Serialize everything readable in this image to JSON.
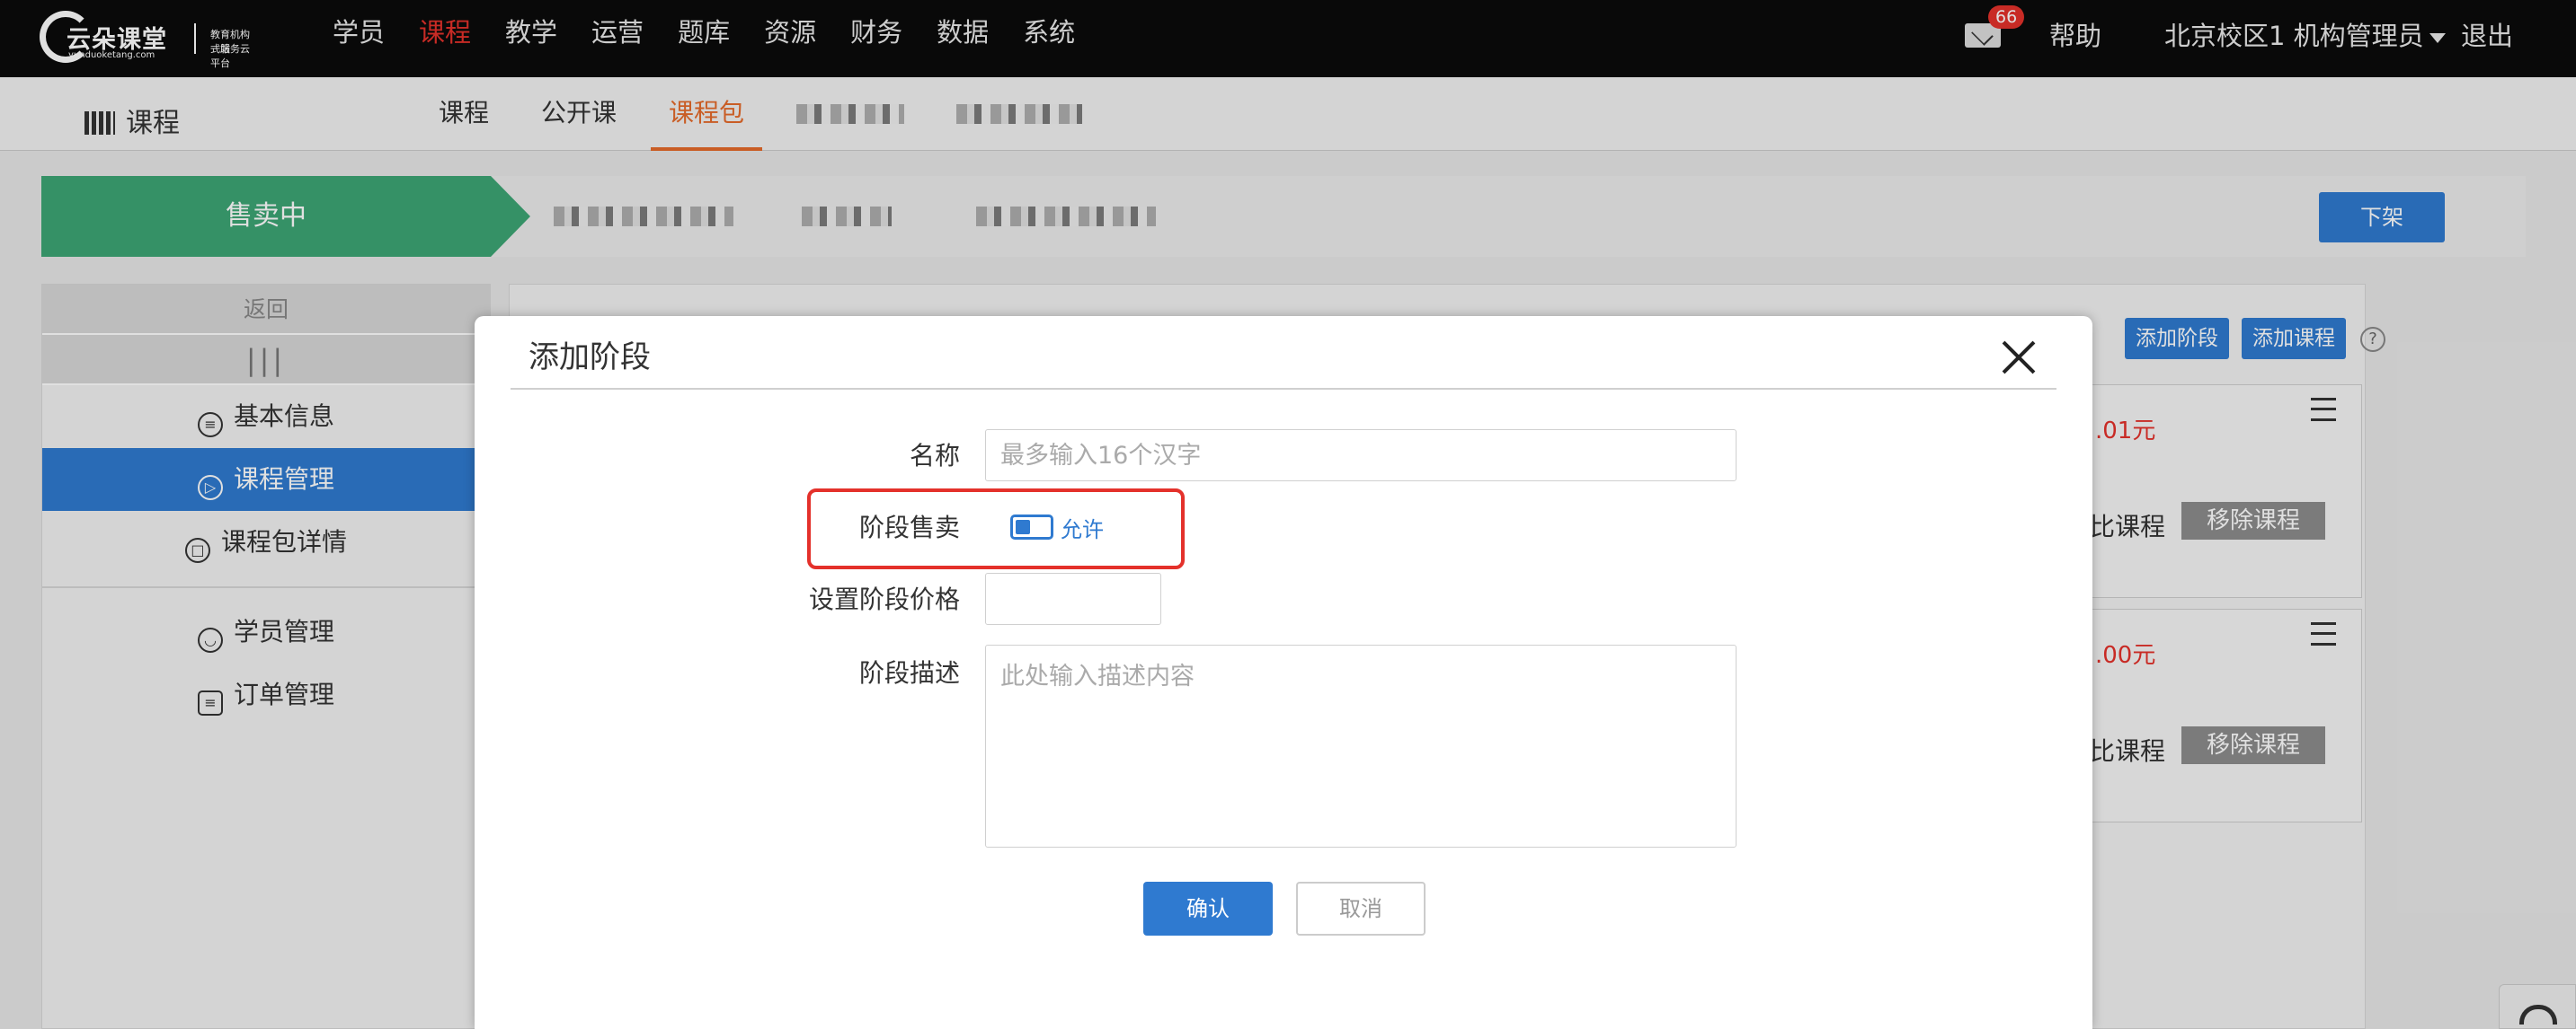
{
  "topnav": {
    "logo_main": "云朵课堂",
    "logo_url": "yunduoketang.com",
    "logo_sub1": "教育机构一站",
    "logo_sub2": "式服务云平台",
    "items": [
      "学员",
      "课程",
      "教学",
      "运营",
      "题库",
      "资源",
      "财务",
      "数据",
      "系统"
    ],
    "active_item": "课程",
    "mail_badge": "66",
    "help": "帮助",
    "user": "北京校区1 机构管理员",
    "logout": "退出"
  },
  "subnav": {
    "title": "课程",
    "tabs": [
      "课程",
      "公开课",
      "课程包"
    ],
    "active_tab": "课程包"
  },
  "status": {
    "sale_label": "售卖中",
    "takeoff_button": "下架"
  },
  "sidebar": {
    "back": "返回",
    "grip": "|||",
    "items": [
      "基本信息",
      "课程管理",
      "课程包详情",
      "学员管理",
      "订单管理"
    ],
    "active_item": "课程管理"
  },
  "content": {
    "add_stage_button": "添加阶段",
    "add_course_button": "添加课程",
    "help_icon_text": "?",
    "cards": [
      {
        "price": ".01元",
        "cut_text": "比课程",
        "remove_button": "移除课程"
      },
      {
        "price": ".00元",
        "cut_text": "比课程",
        "remove_button": "移除课程"
      }
    ]
  },
  "dialog": {
    "title": "添加阶段",
    "name_label": "名称",
    "name_placeholder": "最多输入16个汉字",
    "sell_label": "阶段售卖",
    "sell_toggle_label": "允许",
    "price_label": "设置阶段价格",
    "price_value": "",
    "desc_label": "阶段描述",
    "desc_placeholder": "此处输入描述内容",
    "confirm_button": "确认",
    "cancel_button": "取消"
  },
  "colors": {
    "accent_blue": "#2f7ad0",
    "active_red": "#e4312b",
    "tab_orange": "#e56a2b",
    "sale_green": "#3da675"
  }
}
